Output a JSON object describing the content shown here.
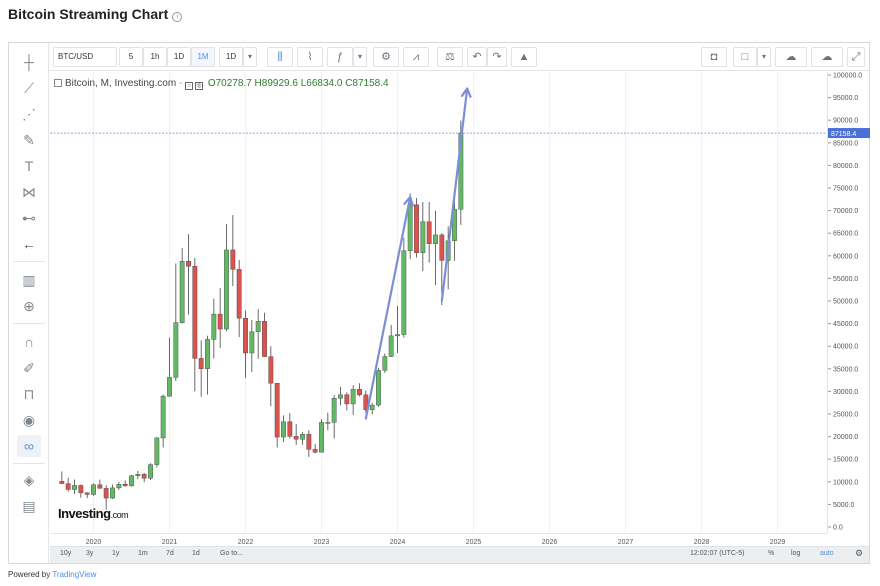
{
  "page": {
    "title": "Bitcoin Streaming Chart",
    "powered_by_prefix": "Powered by",
    "powered_by_link": "TradingView"
  },
  "toolbar": {
    "symbol": "BTC/USD",
    "intervals": [
      "5",
      "1h",
      "1D",
      "1M",
      "1D"
    ],
    "active_interval": "1M"
  },
  "legend": {
    "symbol_text": "Bitcoin, M, Investing.com",
    "open": "O70278.7",
    "high": "H89929.6",
    "low": "L66834.0",
    "close": "C87158.4"
  },
  "logo": {
    "main": "Investing",
    "suffix": ".com"
  },
  "bottom_bar": {
    "ranges": [
      "10y",
      "3y",
      "1y",
      "1m",
      "7d",
      "1d",
      "Go to..."
    ],
    "clock": "12:02:07 (UTC-5)",
    "percent": "%",
    "log": "log",
    "auto": "auto"
  },
  "colors": {
    "up": "#62b867",
    "down": "#d9534f",
    "price_line": "#4a6fd6",
    "arrow": "#7c8fd6",
    "price_tag": "#4a6fd6"
  },
  "chart_data": {
    "type": "candlestick",
    "series_name": "Bitcoin, M, Investing.com",
    "y_axis": {
      "min": 0,
      "max": 100000,
      "ticks": [
        "0.0",
        "5000.0",
        "10000.0",
        "15000.0",
        "20000.0",
        "25000.0",
        "30000.0",
        "35000.0",
        "40000.0",
        "45000.0",
        "50000.0",
        "55000.0",
        "60000.0",
        "65000.0",
        "70000.0",
        "75000.0",
        "80000.0",
        "85000.0",
        "90000.0",
        "95000.0",
        "100000.0"
      ]
    },
    "x_axis": {
      "ticks": [
        "2020",
        "2021",
        "2022",
        "2023",
        "2024",
        "2025",
        "2026",
        "2027",
        "2028",
        "2029"
      ]
    },
    "current_price": {
      "value": 87158.4,
      "label": "87158.4"
    },
    "candles": [
      {
        "d": "2019-08",
        "o": 10100,
        "h": 12300,
        "l": 9500,
        "c": 9600
      },
      {
        "d": "2019-09",
        "o": 9600,
        "h": 10900,
        "l": 7800,
        "c": 8300
      },
      {
        "d": "2019-10",
        "o": 8300,
        "h": 10500,
        "l": 7300,
        "c": 9200
      },
      {
        "d": "2019-11",
        "o": 9200,
        "h": 9400,
        "l": 6500,
        "c": 7550
      },
      {
        "d": "2019-12",
        "o": 7550,
        "h": 7700,
        "l": 6400,
        "c": 7200
      },
      {
        "d": "2020-01",
        "o": 7200,
        "h": 9600,
        "l": 6900,
        "c": 9350
      },
      {
        "d": "2020-02",
        "o": 9350,
        "h": 10500,
        "l": 8500,
        "c": 8550
      },
      {
        "d": "2020-03",
        "o": 8550,
        "h": 9200,
        "l": 3800,
        "c": 6400
      },
      {
        "d": "2020-04",
        "o": 6400,
        "h": 9400,
        "l": 6200,
        "c": 8650
      },
      {
        "d": "2020-05",
        "o": 8650,
        "h": 10000,
        "l": 8200,
        "c": 9450
      },
      {
        "d": "2020-06",
        "o": 9450,
        "h": 10300,
        "l": 8900,
        "c": 9140
      },
      {
        "d": "2020-07",
        "o": 9140,
        "h": 11500,
        "l": 8900,
        "c": 11350
      },
      {
        "d": "2020-08",
        "o": 11350,
        "h": 12400,
        "l": 10600,
        "c": 11650
      },
      {
        "d": "2020-09",
        "o": 11650,
        "h": 12000,
        "l": 9900,
        "c": 10780
      },
      {
        "d": "2020-10",
        "o": 10780,
        "h": 14100,
        "l": 10400,
        "c": 13800
      },
      {
        "d": "2020-11",
        "o": 13800,
        "h": 19900,
        "l": 13200,
        "c": 19700
      },
      {
        "d": "2020-12",
        "o": 19700,
        "h": 29300,
        "l": 17600,
        "c": 28950
      },
      {
        "d": "2021-01",
        "o": 28950,
        "h": 41900,
        "l": 28800,
        "c": 33100
      },
      {
        "d": "2021-02",
        "o": 33100,
        "h": 58300,
        "l": 32300,
        "c": 45200
      },
      {
        "d": "2021-03",
        "o": 45200,
        "h": 61700,
        "l": 45000,
        "c": 58800
      },
      {
        "d": "2021-04",
        "o": 58800,
        "h": 64800,
        "l": 47000,
        "c": 57700
      },
      {
        "d": "2021-05",
        "o": 57700,
        "h": 59500,
        "l": 30000,
        "c": 37300
      },
      {
        "d": "2021-06",
        "o": 37300,
        "h": 41300,
        "l": 28800,
        "c": 35000
      },
      {
        "d": "2021-07",
        "o": 35000,
        "h": 42300,
        "l": 29300,
        "c": 41500
      },
      {
        "d": "2021-08",
        "o": 41500,
        "h": 50500,
        "l": 37300,
        "c": 47100
      },
      {
        "d": "2021-09",
        "o": 47100,
        "h": 52900,
        "l": 39600,
        "c": 43800
      },
      {
        "d": "2021-10",
        "o": 43800,
        "h": 67000,
        "l": 43300,
        "c": 61300
      },
      {
        "d": "2021-11",
        "o": 61300,
        "h": 69000,
        "l": 53300,
        "c": 57000
      },
      {
        "d": "2021-12",
        "o": 57000,
        "h": 59100,
        "l": 42000,
        "c": 46200
      },
      {
        "d": "2022-01",
        "o": 46200,
        "h": 47900,
        "l": 33000,
        "c": 38500
      },
      {
        "d": "2022-02",
        "o": 38500,
        "h": 45800,
        "l": 34300,
        "c": 43200
      },
      {
        "d": "2022-03",
        "o": 43200,
        "h": 48200,
        "l": 37200,
        "c": 45500
      },
      {
        "d": "2022-04",
        "o": 45500,
        "h": 47400,
        "l": 37600,
        "c": 37700
      },
      {
        "d": "2022-05",
        "o": 37700,
        "h": 40000,
        "l": 26700,
        "c": 31800
      },
      {
        "d": "2022-06",
        "o": 31800,
        "h": 31900,
        "l": 17600,
        "c": 19900
      },
      {
        "d": "2022-07",
        "o": 19900,
        "h": 24700,
        "l": 18800,
        "c": 23300
      },
      {
        "d": "2022-08",
        "o": 23300,
        "h": 25200,
        "l": 19600,
        "c": 20050
      },
      {
        "d": "2022-09",
        "o": 20050,
        "h": 22800,
        "l": 18200,
        "c": 19420
      },
      {
        "d": "2022-10",
        "o": 19420,
        "h": 21000,
        "l": 18200,
        "c": 20500
      },
      {
        "d": "2022-11",
        "o": 20500,
        "h": 21400,
        "l": 15500,
        "c": 17170
      },
      {
        "d": "2022-12",
        "o": 17170,
        "h": 18400,
        "l": 16300,
        "c": 16530
      },
      {
        "d": "2023-01",
        "o": 16530,
        "h": 23900,
        "l": 16500,
        "c": 23130
      },
      {
        "d": "2023-02",
        "o": 23130,
        "h": 25300,
        "l": 21400,
        "c": 23150
      },
      {
        "d": "2023-03",
        "o": 23150,
        "h": 29200,
        "l": 19600,
        "c": 28480
      },
      {
        "d": "2023-04",
        "o": 28480,
        "h": 31000,
        "l": 26900,
        "c": 29270
      },
      {
        "d": "2023-05",
        "o": 29270,
        "h": 29800,
        "l": 25800,
        "c": 27220
      },
      {
        "d": "2023-06",
        "o": 27220,
        "h": 31400,
        "l": 24800,
        "c": 30470
      },
      {
        "d": "2023-07",
        "o": 30470,
        "h": 31800,
        "l": 28900,
        "c": 29230
      },
      {
        "d": "2023-08",
        "o": 29230,
        "h": 30200,
        "l": 25300,
        "c": 25940
      },
      {
        "d": "2023-09",
        "o": 25940,
        "h": 27500,
        "l": 24900,
        "c": 26970
      },
      {
        "d": "2023-10",
        "o": 26970,
        "h": 35200,
        "l": 26600,
        "c": 34650
      },
      {
        "d": "2023-11",
        "o": 34650,
        "h": 38400,
        "l": 34100,
        "c": 37720
      },
      {
        "d": "2023-12",
        "o": 37720,
        "h": 44700,
        "l": 37600,
        "c": 42280
      },
      {
        "d": "2024-01",
        "o": 42280,
        "h": 48900,
        "l": 38500,
        "c": 42580
      },
      {
        "d": "2024-02",
        "o": 42580,
        "h": 64000,
        "l": 41900,
        "c": 61130
      },
      {
        "d": "2024-03",
        "o": 61130,
        "h": 73800,
        "l": 59300,
        "c": 71290
      },
      {
        "d": "2024-04",
        "o": 71290,
        "h": 72800,
        "l": 59600,
        "c": 60670
      },
      {
        "d": "2024-05",
        "o": 60670,
        "h": 71900,
        "l": 56600,
        "c": 67530
      },
      {
        "d": "2024-06",
        "o": 67530,
        "h": 71900,
        "l": 58500,
        "c": 62680
      },
      {
        "d": "2024-07",
        "o": 62680,
        "h": 70000,
        "l": 53500,
        "c": 64620
      },
      {
        "d": "2024-08",
        "o": 64620,
        "h": 65000,
        "l": 49100,
        "c": 58970
      },
      {
        "d": "2024-09",
        "o": 58970,
        "h": 66500,
        "l": 52600,
        "c": 63330
      },
      {
        "d": "2024-10",
        "o": 63330,
        "h": 73600,
        "l": 58900,
        "c": 70278.7
      },
      {
        "d": "2024-11",
        "o": 70278.7,
        "h": 89929.6,
        "l": 66834.0,
        "c": 87158.4
      }
    ],
    "annotations": [
      {
        "type": "arrow",
        "from": {
          "d": "2023-08",
          "v": 24000
        },
        "to": {
          "d": "2024-03",
          "v": 73000
        }
      },
      {
        "type": "arrow",
        "from": {
          "d": "2024-08",
          "v": 50000
        },
        "to": {
          "d": "2024-12",
          "v": 97000
        }
      }
    ]
  }
}
